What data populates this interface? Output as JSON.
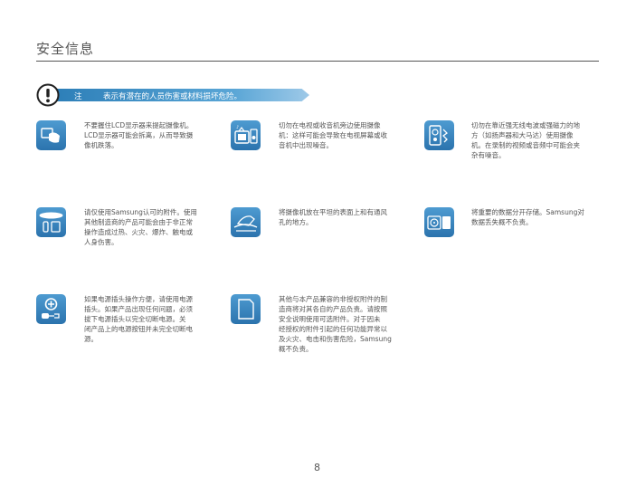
{
  "page": {
    "title": "安全信息",
    "number": "8"
  },
  "notice": {
    "label": "注意",
    "text": "表示有潜在的人员伤害或材料损坏危险。",
    "icon": "exclamation-circle-icon"
  },
  "items": [
    {
      "icon": "lcd-hold-icon",
      "lines": [
        "不要握住LCD显示器来提起摄像机。",
        "LCD显示器可能会拆离，从而导致摄",
        "像机跌落。"
      ]
    },
    {
      "icon": "tv-radio-icon",
      "lines": [
        "切勿在电视或收音机旁边使用摄像",
        "机：这样可能会导致在电视屏幕或收",
        "音机中出现噪音。"
      ]
    },
    {
      "icon": "magnetic-field-icon",
      "lines": [
        "切勿在靠近强无线电波或强磁力的地",
        "方（如扬声器和大马达）使用摄像",
        "机。在录制的视频或音频中可能会夹",
        "杂有噪音。"
      ]
    },
    {
      "icon": "samsung-accessory-icon",
      "lines": [
        "请仅使用Samsung认可的附件。使用",
        "其他制造商的产品可能会由于非正常",
        "操作造成过热、火灾、爆炸、触电或",
        "人身伤害。"
      ]
    },
    {
      "icon": "flat-surface-icon",
      "lines": [
        "将摄像机放在平坦的表面上和有通风",
        "孔的地方。"
      ]
    },
    {
      "icon": "data-backup-icon",
      "lines": [
        "将重要的数据分开存储。Samsung对",
        "数据丢失概不负责。"
      ]
    },
    {
      "icon": "power-plug-icon",
      "lines": [
        "如果电源插头操作方便，请使用电源",
        "插头。如果产品出现任何问题，必须",
        "拔下电源插头以完全切断电源。关",
        "闭产品上的电源按钮并未完全切断电",
        "源。"
      ]
    },
    {
      "icon": "memory-card-icon",
      "lines": [
        "其他与本产品兼容的非授权附件的制",
        "造商将对其各自的产品负责。请按照",
        "安全说明使用可选附件。对于因未",
        "经授权的附件引起的任何功能异常以",
        "及火灾、电击和伤害危险，Samsung",
        "概不负责。"
      ]
    }
  ],
  "colors": {
    "accent": "#2b73ad",
    "text": "#555555"
  }
}
